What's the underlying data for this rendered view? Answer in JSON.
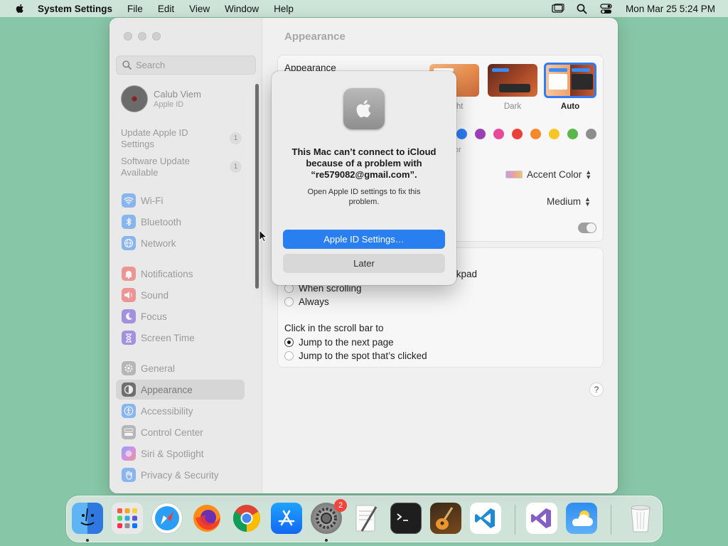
{
  "menubar": {
    "app_name": "System Settings",
    "items": [
      "File",
      "Edit",
      "View",
      "Window",
      "Help"
    ],
    "clock": "Mon Mar 25  5:24 PM"
  },
  "sidebar": {
    "search_placeholder": "Search",
    "user_name": "Calub Viem",
    "user_subtitle": "Apple ID",
    "notices": [
      {
        "label": "Update Apple ID Settings",
        "badge": "1"
      },
      {
        "label": "Software Update Available",
        "badge": "1"
      }
    ],
    "items": [
      {
        "label": "Wi-Fi",
        "icon": "wifi-icon",
        "color": "#3b8cf5"
      },
      {
        "label": "Bluetooth",
        "icon": "bluetooth-icon",
        "color": "#3b8cf5"
      },
      {
        "label": "Network",
        "icon": "globe-icon",
        "color": "#3b8cf5"
      },
      {
        "label": "Notifications",
        "icon": "bell-icon",
        "color": "#f0524d"
      },
      {
        "label": "Sound",
        "icon": "speaker-icon",
        "color": "#f0524d"
      },
      {
        "label": "Focus",
        "icon": "moon-icon",
        "color": "#6a4bd8"
      },
      {
        "label": "Screen Time",
        "icon": "hourglass-icon",
        "color": "#6a4bd8"
      },
      {
        "label": "General",
        "icon": "gear-icon",
        "color": "#8e8e93"
      },
      {
        "label": "Appearance",
        "icon": "appearance-icon",
        "color": "#1c1c1e"
      },
      {
        "label": "Accessibility",
        "icon": "accessibility-icon",
        "color": "#3b8cf5"
      },
      {
        "label": "Control Center",
        "icon": "control-center-icon",
        "color": "#8e8e93"
      },
      {
        "label": "Siri & Spotlight",
        "icon": "siri-icon",
        "color": "#c048e0"
      },
      {
        "label": "Privacy & Security",
        "icon": "hand-icon",
        "color": "#3b8cf5"
      }
    ]
  },
  "main": {
    "title": "Appearance",
    "appearance_label": "Appearance",
    "options": [
      {
        "label": "Light"
      },
      {
        "label": "Dark"
      },
      {
        "label": "Auto"
      }
    ],
    "accent_colors": [
      "#2f7cf6",
      "#9b3fb5",
      "#e84a9a",
      "#e9413c",
      "#f5892b",
      "#f5c625",
      "#5ab84a",
      "#8e8e8e"
    ],
    "accent_fragment": "or",
    "highlight_value": "Accent Color",
    "sidebar_icon_size": "Medium",
    "scroll_fragment": "ckpad",
    "scroll_opts": [
      "When scrolling",
      "Always"
    ],
    "click_label": "Click in the scroll bar to",
    "click_opts": [
      "Jump to the next page",
      "Jump to the spot that’s clicked"
    ],
    "help": "?"
  },
  "dialog": {
    "title": "This Mac can’t connect to iCloud because of a problem with “re579082@gmail.com”.",
    "message": "Open Apple ID settings to fix this problem.",
    "primary_button": "Apple ID Settings…",
    "secondary_button": "Later"
  },
  "dock": {
    "apps": [
      {
        "name": "Finder",
        "badge": ""
      },
      {
        "name": "Launchpad",
        "badge": ""
      },
      {
        "name": "Safari",
        "badge": ""
      },
      {
        "name": "Firefox",
        "badge": ""
      },
      {
        "name": "Chrome",
        "badge": ""
      },
      {
        "name": "App Store",
        "badge": ""
      },
      {
        "name": "System Settings",
        "badge": "2"
      },
      {
        "name": "TextEdit",
        "badge": ""
      },
      {
        "name": "Terminal",
        "badge": ""
      },
      {
        "name": "GarageBand",
        "badge": ""
      },
      {
        "name": "VS Code",
        "badge": ""
      },
      {
        "name": "Visual Studio",
        "badge": ""
      },
      {
        "name": "Weather",
        "badge": ""
      },
      {
        "name": "Trash",
        "badge": ""
      }
    ]
  }
}
